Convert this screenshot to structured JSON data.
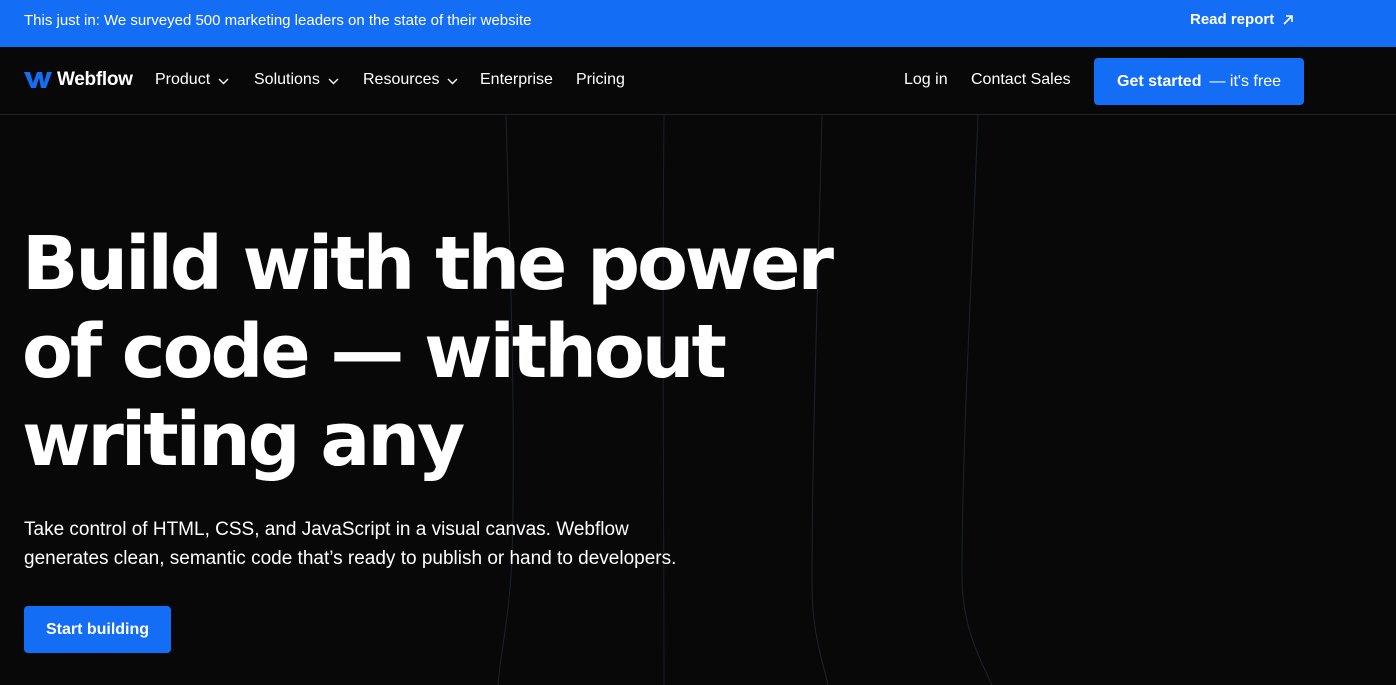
{
  "announcement": {
    "message": "This just in: We surveyed 500 marketing leaders on the state of their website",
    "link_label": "Read report",
    "link_icon": "arrow-up-right-icon"
  },
  "nav": {
    "logo_text": "Webflow",
    "items": [
      {
        "label": "Product",
        "has_dropdown": true
      },
      {
        "label": "Solutions",
        "has_dropdown": true
      },
      {
        "label": "Resources",
        "has_dropdown": true
      },
      {
        "label": "Enterprise",
        "has_dropdown": false
      },
      {
        "label": "Pricing",
        "has_dropdown": false
      }
    ],
    "login_label": "Log in",
    "contact_label": "Contact Sales",
    "cta_strong": "Get started",
    "cta_light": "— it's free"
  },
  "hero": {
    "headline": "Build with the power of code — without writing any",
    "subtext": "Take control of HTML, CSS, and JavaScript in a visual canvas. Webflow generates clean, semantic code that’s ready to publish or hand to developers.",
    "cta_label": "Start building"
  },
  "colors": {
    "brand_blue": "#146ef5",
    "background": "#080808",
    "text": "#ffffff"
  }
}
